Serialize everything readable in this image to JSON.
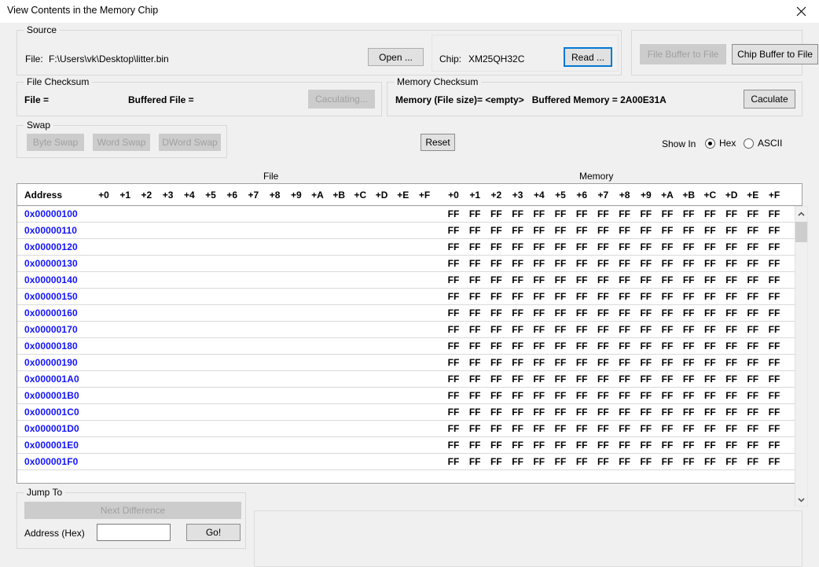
{
  "window": {
    "title": "View Contents in the Memory Chip",
    "close_icon": "close-icon"
  },
  "source": {
    "legend": "Source",
    "file_label": "File:",
    "file_path": "F:\\Users\\vk\\Desktop\\litter.bin",
    "open_button": "Open ...",
    "chip_label": "Chip:",
    "chip_value": "XM25QH32C",
    "read_button": "Read ..."
  },
  "buffer_actions": {
    "file_buffer_to_file": "File Buffer to File",
    "chip_buffer_to_file": "Chip Buffer to File"
  },
  "file_checksum": {
    "legend": "File Checksum",
    "file_eq": "File =",
    "buffered_file_eq": "Buffered File =",
    "calculating_button": "Caculating..."
  },
  "memory_checksum": {
    "legend": "Memory Checksum",
    "summary": "Memory (File size)= <empty>   Buffered Memory = 2A00E31A",
    "calculate_button": "Caculate"
  },
  "swap": {
    "legend": "Swap",
    "byte_swap": "Byte Swap",
    "word_swap": "Word Swap",
    "dword_swap": "DWord Swap"
  },
  "reset_button": "Reset",
  "show_in": {
    "label": "Show In",
    "options": [
      "Hex",
      "ASCII"
    ],
    "selected": "Hex"
  },
  "grid": {
    "file_section_title": "File",
    "memory_section_title": "Memory",
    "address_header": "Address",
    "byte_headers": [
      "+0",
      "+1",
      "+2",
      "+3",
      "+4",
      "+5",
      "+6",
      "+7",
      "+8",
      "+9",
      "+A",
      "+B",
      "+C",
      "+D",
      "+E",
      "+F"
    ],
    "address_color": "#1414FF",
    "rows": [
      {
        "address": "0x00000100",
        "file": [
          "",
          "",
          "",
          "",
          "",
          "",
          "",
          "",
          "",
          "",
          "",
          "",
          "",
          "",
          "",
          ""
        ],
        "memory": [
          "FF",
          "FF",
          "FF",
          "FF",
          "FF",
          "FF",
          "FF",
          "FF",
          "FF",
          "FF",
          "FF",
          "FF",
          "FF",
          "FF",
          "FF",
          "FF"
        ]
      },
      {
        "address": "0x00000110",
        "file": [
          "",
          "",
          "",
          "",
          "",
          "",
          "",
          "",
          "",
          "",
          "",
          "",
          "",
          "",
          "",
          ""
        ],
        "memory": [
          "FF",
          "FF",
          "FF",
          "FF",
          "FF",
          "FF",
          "FF",
          "FF",
          "FF",
          "FF",
          "FF",
          "FF",
          "FF",
          "FF",
          "FF",
          "FF"
        ]
      },
      {
        "address": "0x00000120",
        "file": [
          "",
          "",
          "",
          "",
          "",
          "",
          "",
          "",
          "",
          "",
          "",
          "",
          "",
          "",
          "",
          ""
        ],
        "memory": [
          "FF",
          "FF",
          "FF",
          "FF",
          "FF",
          "FF",
          "FF",
          "FF",
          "FF",
          "FF",
          "FF",
          "FF",
          "FF",
          "FF",
          "FF",
          "FF"
        ]
      },
      {
        "address": "0x00000130",
        "file": [
          "",
          "",
          "",
          "",
          "",
          "",
          "",
          "",
          "",
          "",
          "",
          "",
          "",
          "",
          "",
          ""
        ],
        "memory": [
          "FF",
          "FF",
          "FF",
          "FF",
          "FF",
          "FF",
          "FF",
          "FF",
          "FF",
          "FF",
          "FF",
          "FF",
          "FF",
          "FF",
          "FF",
          "FF"
        ]
      },
      {
        "address": "0x00000140",
        "file": [
          "",
          "",
          "",
          "",
          "",
          "",
          "",
          "",
          "",
          "",
          "",
          "",
          "",
          "",
          "",
          ""
        ],
        "memory": [
          "FF",
          "FF",
          "FF",
          "FF",
          "FF",
          "FF",
          "FF",
          "FF",
          "FF",
          "FF",
          "FF",
          "FF",
          "FF",
          "FF",
          "FF",
          "FF"
        ]
      },
      {
        "address": "0x00000150",
        "file": [
          "",
          "",
          "",
          "",
          "",
          "",
          "",
          "",
          "",
          "",
          "",
          "",
          "",
          "",
          "",
          ""
        ],
        "memory": [
          "FF",
          "FF",
          "FF",
          "FF",
          "FF",
          "FF",
          "FF",
          "FF",
          "FF",
          "FF",
          "FF",
          "FF",
          "FF",
          "FF",
          "FF",
          "FF"
        ]
      },
      {
        "address": "0x00000160",
        "file": [
          "",
          "",
          "",
          "",
          "",
          "",
          "",
          "",
          "",
          "",
          "",
          "",
          "",
          "",
          "",
          ""
        ],
        "memory": [
          "FF",
          "FF",
          "FF",
          "FF",
          "FF",
          "FF",
          "FF",
          "FF",
          "FF",
          "FF",
          "FF",
          "FF",
          "FF",
          "FF",
          "FF",
          "FF"
        ]
      },
      {
        "address": "0x00000170",
        "file": [
          "",
          "",
          "",
          "",
          "",
          "",
          "",
          "",
          "",
          "",
          "",
          "",
          "",
          "",
          "",
          ""
        ],
        "memory": [
          "FF",
          "FF",
          "FF",
          "FF",
          "FF",
          "FF",
          "FF",
          "FF",
          "FF",
          "FF",
          "FF",
          "FF",
          "FF",
          "FF",
          "FF",
          "FF"
        ]
      },
      {
        "address": "0x00000180",
        "file": [
          "",
          "",
          "",
          "",
          "",
          "",
          "",
          "",
          "",
          "",
          "",
          "",
          "",
          "",
          "",
          ""
        ],
        "memory": [
          "FF",
          "FF",
          "FF",
          "FF",
          "FF",
          "FF",
          "FF",
          "FF",
          "FF",
          "FF",
          "FF",
          "FF",
          "FF",
          "FF",
          "FF",
          "FF"
        ]
      },
      {
        "address": "0x00000190",
        "file": [
          "",
          "",
          "",
          "",
          "",
          "",
          "",
          "",
          "",
          "",
          "",
          "",
          "",
          "",
          "",
          ""
        ],
        "memory": [
          "FF",
          "FF",
          "FF",
          "FF",
          "FF",
          "FF",
          "FF",
          "FF",
          "FF",
          "FF",
          "FF",
          "FF",
          "FF",
          "FF",
          "FF",
          "FF"
        ]
      },
      {
        "address": "0x000001A0",
        "file": [
          "",
          "",
          "",
          "",
          "",
          "",
          "",
          "",
          "",
          "",
          "",
          "",
          "",
          "",
          "",
          ""
        ],
        "memory": [
          "FF",
          "FF",
          "FF",
          "FF",
          "FF",
          "FF",
          "FF",
          "FF",
          "FF",
          "FF",
          "FF",
          "FF",
          "FF",
          "FF",
          "FF",
          "FF"
        ]
      },
      {
        "address": "0x000001B0",
        "file": [
          "",
          "",
          "",
          "",
          "",
          "",
          "",
          "",
          "",
          "",
          "",
          "",
          "",
          "",
          "",
          ""
        ],
        "memory": [
          "FF",
          "FF",
          "FF",
          "FF",
          "FF",
          "FF",
          "FF",
          "FF",
          "FF",
          "FF",
          "FF",
          "FF",
          "FF",
          "FF",
          "FF",
          "FF"
        ]
      },
      {
        "address": "0x000001C0",
        "file": [
          "",
          "",
          "",
          "",
          "",
          "",
          "",
          "",
          "",
          "",
          "",
          "",
          "",
          "",
          "",
          ""
        ],
        "memory": [
          "FF",
          "FF",
          "FF",
          "FF",
          "FF",
          "FF",
          "FF",
          "FF",
          "FF",
          "FF",
          "FF",
          "FF",
          "FF",
          "FF",
          "FF",
          "FF"
        ]
      },
      {
        "address": "0x000001D0",
        "file": [
          "",
          "",
          "",
          "",
          "",
          "",
          "",
          "",
          "",
          "",
          "",
          "",
          "",
          "",
          "",
          ""
        ],
        "memory": [
          "FF",
          "FF",
          "FF",
          "FF",
          "FF",
          "FF",
          "FF",
          "FF",
          "FF",
          "FF",
          "FF",
          "FF",
          "FF",
          "FF",
          "FF",
          "FF"
        ]
      },
      {
        "address": "0x000001E0",
        "file": [
          "",
          "",
          "",
          "",
          "",
          "",
          "",
          "",
          "",
          "",
          "",
          "",
          "",
          "",
          "",
          ""
        ],
        "memory": [
          "FF",
          "FF",
          "FF",
          "FF",
          "FF",
          "FF",
          "FF",
          "FF",
          "FF",
          "FF",
          "FF",
          "FF",
          "FF",
          "FF",
          "FF",
          "FF"
        ]
      },
      {
        "address": "0x000001F0",
        "file": [
          "",
          "",
          "",
          "",
          "",
          "",
          "",
          "",
          "",
          "",
          "",
          "",
          "",
          "",
          "",
          ""
        ],
        "memory": [
          "FF",
          "FF",
          "FF",
          "FF",
          "FF",
          "FF",
          "FF",
          "FF",
          "FF",
          "FF",
          "FF",
          "FF",
          "FF",
          "FF",
          "FF",
          "FF"
        ]
      }
    ]
  },
  "scrollbar": {
    "up_icon": "chevron-up-icon",
    "down_icon": "chevron-down-icon"
  },
  "jump_to": {
    "legend": "Jump To",
    "next_difference_button": "Next Difference",
    "address_label": "Address (Hex)",
    "address_value": "",
    "address_placeholder": "",
    "go_button": "Go!"
  }
}
